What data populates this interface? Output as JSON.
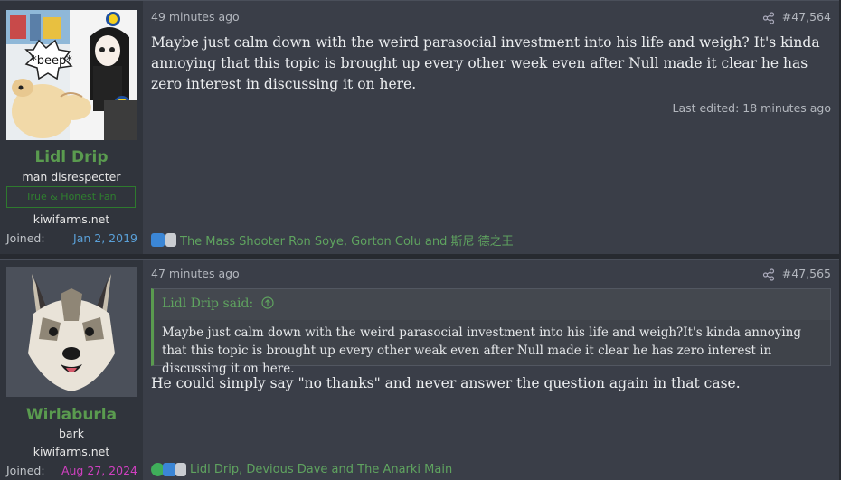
{
  "posts": [
    {
      "username": "Lidl Drip",
      "user_title": "man disrespecter",
      "banner": "True & Honest Fan",
      "site": "kiwifarms.net",
      "joined_label": "Joined:",
      "joined_date": "Jan 2, 2019",
      "avatar_text": "*beep*",
      "avatar_logo": "Lidl",
      "time": "49 minutes ago",
      "post_number": "#47,564",
      "body": "Maybe just calm down with the weird parasocial investment into his life and weigh? It's kinda annoying that this topic is brought up every other week even after Null made it clear he has zero interest in discussing it on here.",
      "edited": "Last edited: 18 minutes ago",
      "reactions": "The Mass Shooter Ron Soye, Gorton Colu and 斯尼 德之王"
    },
    {
      "username": "Wirlaburla",
      "user_title": "bark",
      "site": "kiwifarms.net",
      "joined_label": "Joined:",
      "joined_date": "Aug 27, 2024",
      "time": "47 minutes ago",
      "post_number": "#47,565",
      "quote_author": "Lidl Drip said:",
      "quote_body": "Maybe just calm down with the weird parasocial investment into his life and weigh?It's kinda annoying that this topic is brought up every other weak even after Null made it clear he has zero interest in discussing it on here.",
      "body": "He could simply say \"no thanks\" and never answer the question again in that case.",
      "reactions": "Lidl Drip, Devious Dave and The Anarki Main"
    }
  ],
  "colors": {
    "username": "#5a9b4f",
    "joined_date_1": "#5aa0d8",
    "joined_date_2": "#d040c0",
    "reactions": "#5fa35f"
  },
  "icons": [
    "share-icon",
    "quote-arrow-icon",
    "like-reaction-icon",
    "newspaper-reaction-icon",
    "check-reaction-icon"
  ]
}
